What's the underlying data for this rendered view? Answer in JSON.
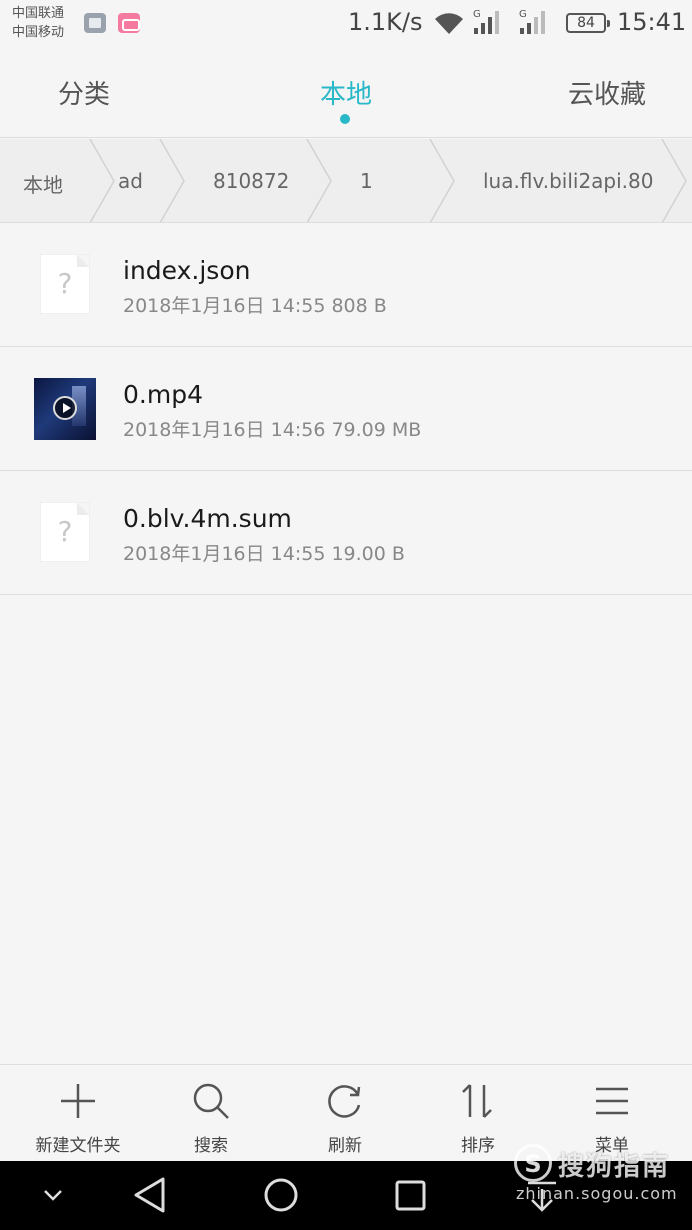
{
  "status_bar": {
    "carrier_1": "中国联通",
    "carrier_2": "中国移动",
    "net_speed": "1.1K/s",
    "signal_label": "G",
    "battery": "84",
    "time": "15:41",
    "icons": [
      "gallery-icon",
      "bilibili-icon",
      "wifi-icon",
      "signal-icon",
      "battery-icon"
    ]
  },
  "tabs": [
    {
      "label": "分类",
      "active": false
    },
    {
      "label": "本地",
      "active": true
    },
    {
      "label": "云收藏",
      "active": false
    }
  ],
  "breadcrumb": [
    "本地",
    "ad",
    "810872",
    "1",
    "lua.flv.bili2api.80"
  ],
  "files": [
    {
      "name": "index.json",
      "meta": "2018年1月16日 14:55 808 B",
      "icon": "unknown-file-icon"
    },
    {
      "name": "0.mp4",
      "meta": "2018年1月16日 14:56 79.09 MB",
      "icon": "video-thumbnail"
    },
    {
      "name": "0.blv.4m.sum",
      "meta": "2018年1月16日 14:55 19.00 B",
      "icon": "unknown-file-icon"
    }
  ],
  "toolbar": {
    "new_folder": "新建文件夹",
    "search": "搜索",
    "refresh": "刷新",
    "sort": "排序",
    "menu": "菜单"
  },
  "watermark": {
    "text": "搜狗指南",
    "url": "zhinan.sogou.com"
  },
  "colors": {
    "accent": "#29b8c8",
    "background": "#f5f5f5",
    "nav_bar": "#000000"
  }
}
